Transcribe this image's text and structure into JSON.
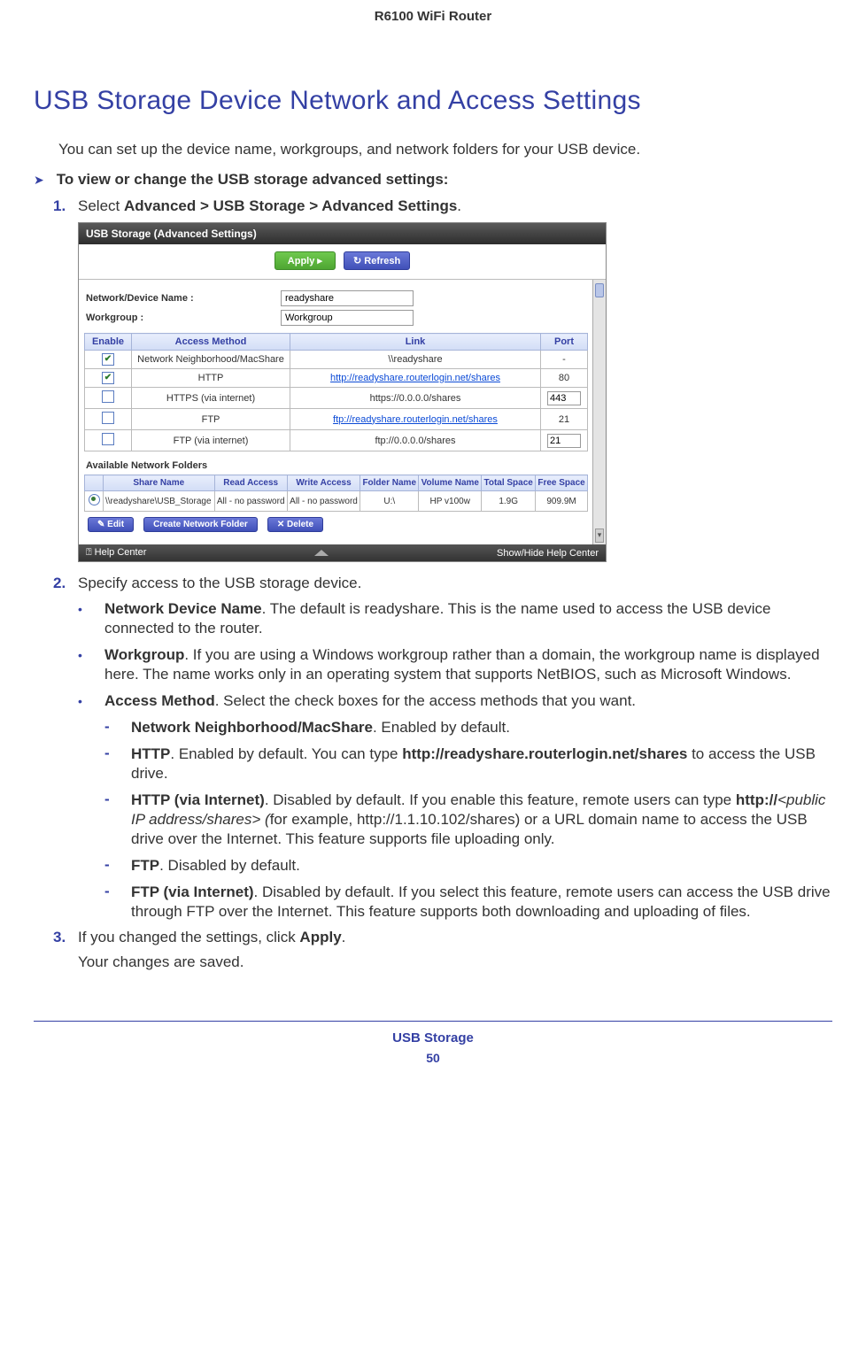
{
  "header": {
    "product": "R6100 WiFi Router"
  },
  "heading": "USB Storage Device Network and Access Settings",
  "intro": "You can set up the device name, workgroups, and network folders for your USB device.",
  "task": "To view or change the USB storage advanced settings:",
  "step1": {
    "num": "1.",
    "prefix": "Select ",
    "bold": "Advanced > USB Storage > Advanced Settings",
    "suffix": "."
  },
  "screenshot": {
    "title": "USB Storage (Advanced Settings)",
    "apply": "Apply ▸",
    "refresh": "↻ Refresh",
    "ndn_label": "Network/Device Name :",
    "ndn_value": "readyshare",
    "wg_label": "Workgroup :",
    "wg_value": "Workgroup",
    "cols": {
      "enable": "Enable",
      "method": "Access Method",
      "link": "Link",
      "port": "Port"
    },
    "rows": [
      {
        "checked": true,
        "method": "Network Neighborhood/MacShare",
        "link": "\\\\readyshare",
        "linkblue": false,
        "port": "-",
        "portbox": false
      },
      {
        "checked": true,
        "method": "HTTP",
        "link": "http://readyshare.routerlogin.net/shares",
        "linkblue": true,
        "port": "80",
        "portbox": false
      },
      {
        "checked": false,
        "method": "HTTPS (via internet)",
        "link": "https://0.0.0.0/shares",
        "linkblue": false,
        "port": "443",
        "portbox": true
      },
      {
        "checked": false,
        "method": "FTP",
        "link": "ftp://readyshare.routerlogin.net/shares",
        "linkblue": true,
        "port": "21",
        "portbox": false
      },
      {
        "checked": false,
        "method": "FTP (via internet)",
        "link": "ftp://0.0.0.0/shares",
        "linkblue": false,
        "port": "21",
        "portbox": true
      }
    ],
    "avail": "Available Network Folders",
    "fcols": {
      "share": "Share Name",
      "read": "Read Access",
      "write": "Write Access",
      "folder": "Folder Name",
      "volume": "Volume Name",
      "total": "Total Space",
      "free": "Free Space"
    },
    "frow": {
      "share": "\\\\readyshare\\USB_Storage",
      "read": "All - no password",
      "write": "All - no password",
      "folder": "U:\\",
      "volume": "HP v100w",
      "total": "1.9G",
      "free": "909.9M"
    },
    "edit": "✎ Edit",
    "create": "Create Network Folder",
    "delete": "✕ Delete",
    "help": "⍰ Help Center",
    "showhide": "Show/Hide Help Center"
  },
  "step2": {
    "num": "2.",
    "text": "Specify access to the USB storage device."
  },
  "b1": {
    "bold": "Network Device Name",
    "text": ". The default is readyshare. This is the name used to access the USB device connected to the router."
  },
  "b2": {
    "bold": "Workgroup",
    "text": ". If you are using a Windows workgroup rather than a domain, the workgroup name is displayed here. The name works only in an operating system that supports NetBIOS, such as Microsoft Windows."
  },
  "b3": {
    "bold": "Access Method",
    "text": ". Select the check boxes for the access methods that you want."
  },
  "s1": {
    "bold": "Network Neighborhood/MacShare",
    "text": ". Enabled by default."
  },
  "s2": {
    "bold": "HTTP",
    "mid": ". Enabled by default. You can type ",
    "bold2": "http://readyshare.routerlogin.net/shares",
    "suffix": " to access the USB drive."
  },
  "s3": {
    "bold": "HTTP (via Internet)",
    "mid": ". Disabled by default. If you enable this feature, remote users can type ",
    "bold2": "http://",
    "italic": "<public IP address/shares> (",
    "suffix": "for example, http://1.1.10.102/shares) or a URL domain name to access the USB drive over the Internet. This feature supports file uploading only."
  },
  "s4": {
    "bold": "FTP",
    "text": ". Disabled by default."
  },
  "s5": {
    "bold": "FTP (via Internet)",
    "text": ". Disabled by default. If you select this feature, remote users can access the USB drive through FTP over the Internet. This feature supports both downloading and uploading of files."
  },
  "step3": {
    "num": "3.",
    "prefix": "If you changed the settings, click ",
    "bold": "Apply",
    "suffix": "."
  },
  "step3b": "Your changes are saved.",
  "footer": {
    "section": "USB Storage",
    "page": "50"
  }
}
